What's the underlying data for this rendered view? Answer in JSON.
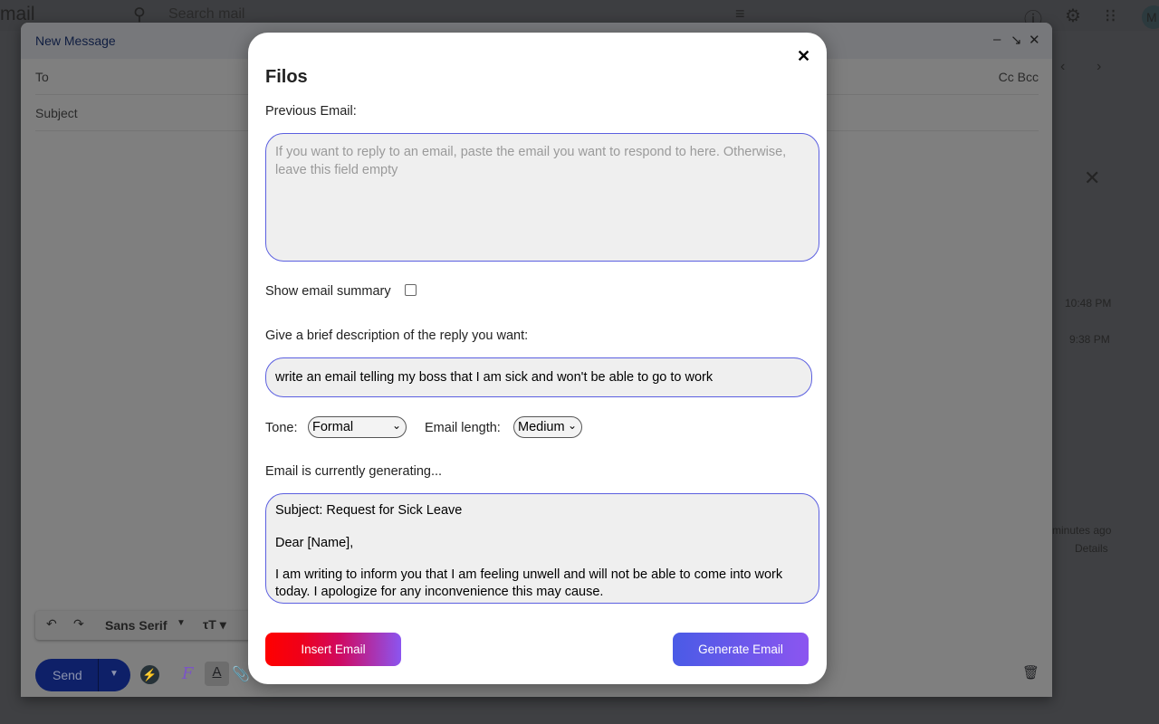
{
  "gmail": {
    "logo_text": "mail",
    "search_placeholder": "Search mail",
    "times": [
      "10:48 PM",
      "9:38 PM"
    ],
    "minutes_ago": "minutes ago",
    "details": "Details",
    "avatar_initial": "M"
  },
  "compose": {
    "title": "New Message",
    "to_label": "To",
    "cc_bcc": "Cc Bcc",
    "subject_placeholder": "Subject",
    "font_name": "Sans Serif",
    "send_label": "Send"
  },
  "modal": {
    "title": "Filos",
    "previous_email_label": "Previous Email:",
    "previous_email_placeholder": "If you want to reply to an email, paste the email you want to respond to here. Otherwise, leave this field empty",
    "show_summary_label": "Show email summary",
    "show_summary_checked": false,
    "description_label": "Give a brief description of the reply you want:",
    "description_value": "write an email telling my boss that I am sick and won't be able to go to work",
    "tone_label": "Tone:",
    "tone_value": "Formal",
    "length_label": "Email length:",
    "length_value": "Medium",
    "status": "Email is currently generating...",
    "output_lines": [
      "Subject: Request for Sick Leave",
      "Dear [Name],",
      "I am writing to inform you that I am feeling unwell and will not be able to come into work today. I apologize for any inconvenience this may cause."
    ],
    "insert_label": "Insert Email",
    "generate_label": "Generate Email",
    "colors": {
      "accent_border": "#5b5fe0",
      "insert_gradient": [
        "#ff0000",
        "#8b55f0"
      ],
      "generate_gradient": [
        "#4a5be6",
        "#8c55f0"
      ]
    }
  }
}
